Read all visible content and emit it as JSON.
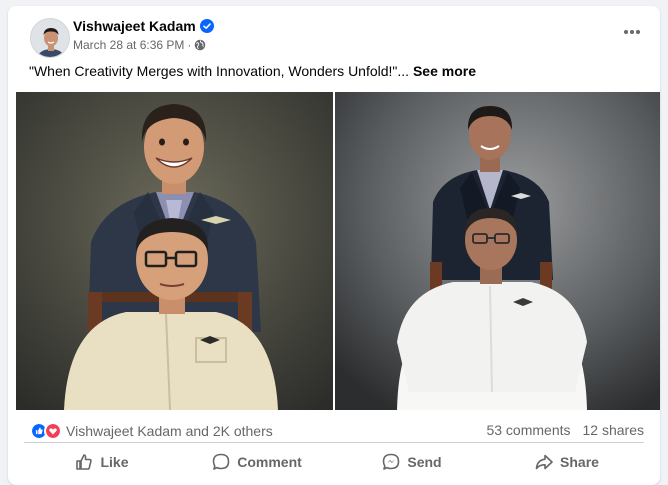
{
  "post": {
    "author": "Vishwajeet Kadam",
    "timestamp": "March 28 at 6:36 PM",
    "separator": "·",
    "privacy_icon": "globe-icon",
    "verified_icon": "verified-badge-icon",
    "caption": "\"When Creativity Merges with Innovation, Wonders Unfold!\"...",
    "see_more": "See more"
  },
  "stats": {
    "reaction_icons": [
      "like-reaction-icon",
      "love-reaction-icon"
    ],
    "reactions_text": "Vishwajeet Kadam and 2K others",
    "comments": "53 comments",
    "shares": "12 shares"
  },
  "actions": [
    {
      "label": "Like",
      "icon": "thumbs-up-icon"
    },
    {
      "label": "Comment",
      "icon": "comment-icon"
    },
    {
      "label": "Send",
      "icon": "send-icon"
    },
    {
      "label": "Share",
      "icon": "share-icon"
    }
  ],
  "colors": {
    "like_blue": "#0866ff",
    "love_red": "#f33e58",
    "text_secondary": "#65676b",
    "verified_blue": "#0866ff"
  }
}
